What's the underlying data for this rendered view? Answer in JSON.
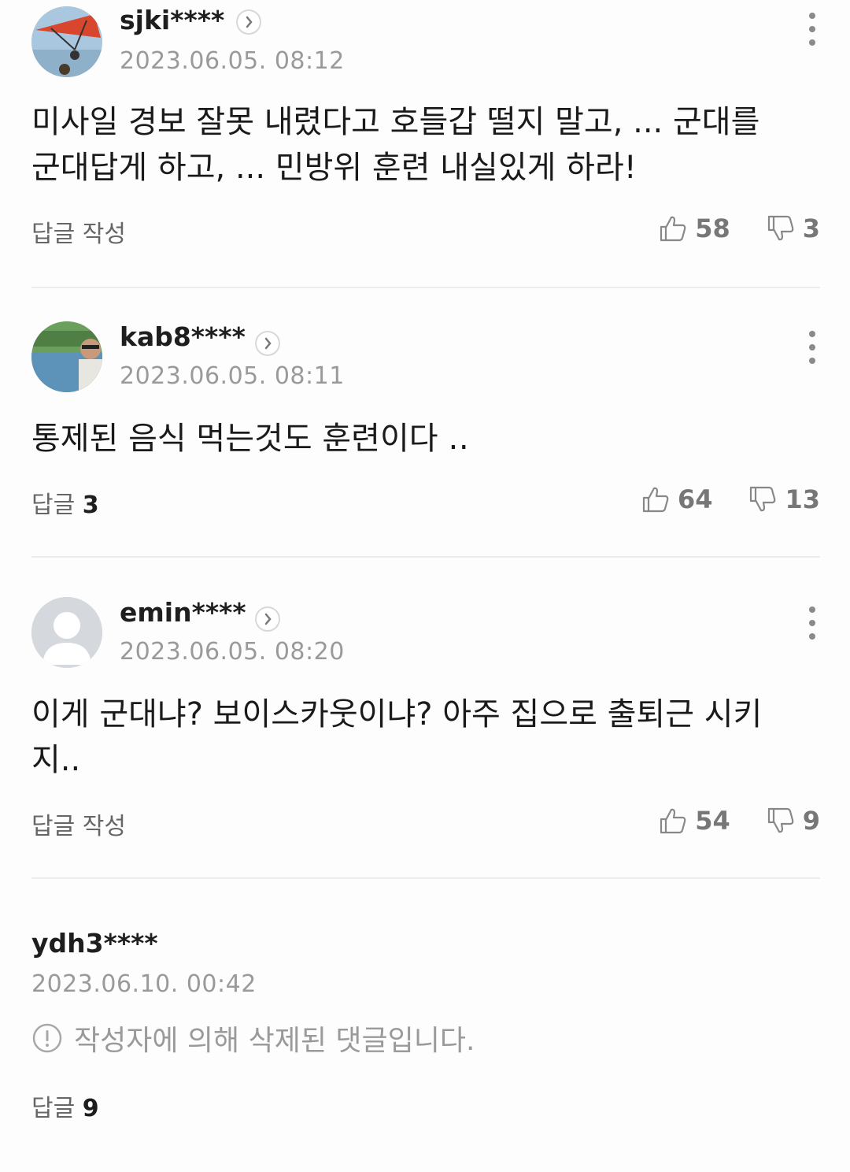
{
  "comments": [
    {
      "username": "sjki****",
      "timestamp": "2023.06.05. 08:12",
      "text": "미사일 경보 잘못 내렸다고 호들갑 떨지 말고, ... 군대를 군대답게 하고, ... 민방위 훈련 내실있게 하라!",
      "reply_label": "답글 작성",
      "reply_count": "",
      "likes": "58",
      "dislikes": "3",
      "avatar": "hang-glider-photo"
    },
    {
      "username": "kab8****",
      "timestamp": "2023.06.05. 08:11",
      "text": "통제된 음식 먹는것도 훈련이다 ‥",
      "reply_label": "답글",
      "reply_count": "3",
      "likes": "64",
      "dislikes": "13",
      "avatar": "lake-selfie-photo"
    },
    {
      "username": "emin****",
      "timestamp": "2023.06.05. 08:20",
      "text": "이게 군대냐? 보이스카웃이냐? 아주 집으로 출퇴근 시키지..",
      "reply_label": "답글 작성",
      "reply_count": "",
      "likes": "54",
      "dislikes": "9",
      "avatar": "default-person-icon"
    }
  ],
  "deleted_comment": {
    "username": "ydh3****",
    "timestamp": "2023.06.10. 00:42",
    "message": "작성자에 의해 삭제된 댓글입니다.",
    "reply_label": "답글",
    "reply_count": "9"
  },
  "icons": {
    "like": "thumbs-up-icon",
    "dislike": "thumbs-down-icon",
    "more": "vertical-dots-icon",
    "profile": "chevron-right-icon",
    "deleted": "exclamation-circle-icon"
  },
  "colors": {
    "username": "#1e1e1e",
    "meta": "#9a9a9a",
    "divider": "#ececec"
  }
}
